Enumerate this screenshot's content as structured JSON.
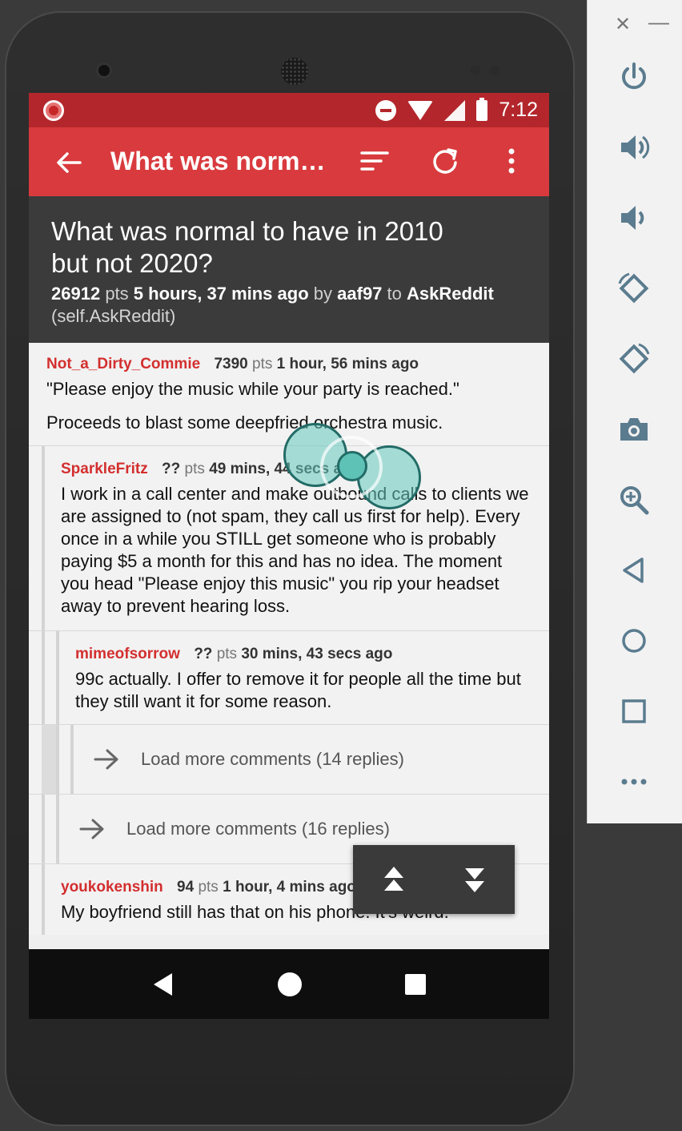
{
  "status_bar": {
    "time": "7:12"
  },
  "toolbar": {
    "title": "What was norm…",
    "back_icon": "arrow-left-icon",
    "sort_icon": "sort-icon",
    "refresh_icon": "refresh-icon",
    "menu_icon": "more-vert-icon"
  },
  "post": {
    "title": "What was normal to have in 2010 but not 2020?",
    "points": "26912",
    "points_label": "pts",
    "time": "5 hours, 37 mins ago",
    "by_label": "by",
    "author": "aaf97",
    "to_label": "to",
    "subreddit": "AskReddit",
    "domain": "(self.AskReddit)"
  },
  "comments": [
    {
      "author": "Not_a_Dirty_Commie",
      "points": "7390",
      "points_label": "pts",
      "time": "1 hour, 56 mins ago",
      "body": [
        "\"Please enjoy the music while your party is reached.\"",
        "Proceeds to blast some deepfried orchestra music."
      ]
    },
    {
      "author": "SparkleFritz",
      "points": "??",
      "points_label": "pts",
      "time": "49 mins, 44 secs ago",
      "body": [
        "I work in a call center and make outbound calls to clients we are assigned to (not spam, they call us first for help).  Every once in a while you STILL get someone who is probably paying $5 a month for this and has no idea. The moment you head \"Please enjoy this music\" you rip your headset away to prevent hearing loss."
      ]
    },
    {
      "author": "mimeofsorrow",
      "points": "??",
      "points_label": "pts",
      "time": "30 mins, 43 secs ago",
      "body": [
        "99c actually. I offer to remove it for people all the time but they still want it for some reason."
      ]
    },
    {
      "author": "youkokenshin",
      "points": "94",
      "points_label": "pts",
      "time": "1 hour, 4 mins ago",
      "body": [
        "My boyfriend still has that on his phone. It's weird."
      ]
    }
  ],
  "load_more": [
    {
      "label": "Load more comments (14 replies)"
    },
    {
      "label": "Load more comments (16 replies)"
    }
  ],
  "floating_nav": {
    "up_icon": "double-chevron-up-icon",
    "down_icon": "double-chevron-down-icon"
  },
  "nav_bar": {
    "back_icon": "nav-back-icon",
    "home_icon": "nav-home-icon",
    "recents_icon": "nav-recents-icon"
  },
  "emulator_panel": {
    "close": "✕",
    "minimize": "—",
    "icons": [
      "power-icon",
      "volume-up-icon",
      "volume-down-icon",
      "rotate-left-icon",
      "rotate-right-icon",
      "camera-icon",
      "zoom-icon",
      "back-icon",
      "home-icon",
      "overview-icon",
      "more-icon"
    ]
  },
  "colors": {
    "status_bar": "#b3262b",
    "toolbar": "#d93a3d",
    "author": "#d32f2f",
    "post_header": "#3b3b3b"
  }
}
